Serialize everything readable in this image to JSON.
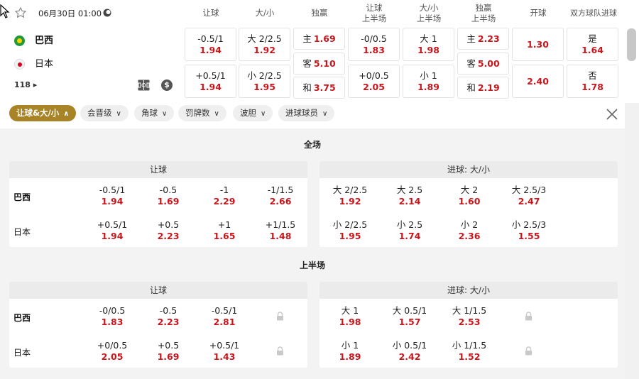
{
  "header": {
    "date": "06月30日 01:00",
    "teams": [
      {
        "name": "巴西",
        "flag": "brazil-flag"
      },
      {
        "name": "日本",
        "flag": "japan-flag"
      }
    ],
    "more_markets": "118",
    "columns": [
      {
        "label": "让球"
      },
      {
        "label": "大/小"
      },
      {
        "label": "独赢"
      },
      {
        "label": "让球\n上半场"
      },
      {
        "label": "大/小\n上半场"
      },
      {
        "label": "独赢\n上半场"
      },
      {
        "label": "开球"
      },
      {
        "label": "双方球队进球"
      }
    ],
    "cells": {
      "hcp_home": {
        "line": "-0.5/1",
        "odds": "1.94"
      },
      "hcp_away": {
        "line": "+0.5/1",
        "odds": "1.94"
      },
      "ou_over": {
        "line": "大 2/2.5",
        "odds": "1.92"
      },
      "ou_under": {
        "line": "小 2/2.5",
        "odds": "1.95"
      },
      "ml_home": {
        "line": "主",
        "odds": "1.69"
      },
      "ml_away": {
        "line": "客",
        "odds": "5.10"
      },
      "ml_draw": {
        "line": "和",
        "odds": "3.75"
      },
      "h1_hcp_home": {
        "line": "-0/0.5",
        "odds": "1.83"
      },
      "h1_hcp_away": {
        "line": "+0/0.5",
        "odds": "2.05"
      },
      "h1_ou_over": {
        "line": "大 1",
        "odds": "1.98"
      },
      "h1_ou_under": {
        "line": "小 1",
        "odds": "1.89"
      },
      "h1_ml_home": {
        "line": "主",
        "odds": "2.23"
      },
      "h1_ml_away": {
        "line": "客",
        "odds": "5.00"
      },
      "h1_ml_draw": {
        "line": "和",
        "odds": "2.19"
      },
      "kickoff_home": {
        "odds": "1.30"
      },
      "kickoff_away": {
        "odds": "2.40"
      },
      "btts_yes": {
        "line": "是",
        "odds": "1.64"
      },
      "btts_no": {
        "line": "否",
        "odds": "1.78"
      }
    }
  },
  "filters": [
    {
      "label": "让球&大/小",
      "active": true
    },
    {
      "label": "会晋级"
    },
    {
      "label": "角球"
    },
    {
      "label": "罚牌数"
    },
    {
      "label": "波胆"
    },
    {
      "label": "进球球员"
    }
  ],
  "sections": [
    {
      "title": "全场",
      "left": {
        "header": "让球",
        "rows": [
          {
            "team": "巴西",
            "odds": [
              {
                "line": "-0.5/1",
                "odds": "1.94"
              },
              {
                "line": "-0.5",
                "odds": "1.69"
              },
              {
                "line": "-1",
                "odds": "2.29"
              },
              {
                "line": "-1/1.5",
                "odds": "2.66"
              }
            ]
          },
          {
            "team": "日本",
            "odds": [
              {
                "line": "+0.5/1",
                "odds": "1.94"
              },
              {
                "line": "+0.5",
                "odds": "2.23"
              },
              {
                "line": "+1",
                "odds": "1.65"
              },
              {
                "line": "+1/1.5",
                "odds": "1.48"
              }
            ]
          }
        ]
      },
      "right": {
        "header": "进球: 大/小",
        "rows": [
          {
            "odds": [
              {
                "line": "大 2/2.5",
                "odds": "1.92"
              },
              {
                "line": "大 2.5",
                "odds": "2.14"
              },
              {
                "line": "大 2",
                "odds": "1.60"
              },
              {
                "line": "大 2.5/3",
                "odds": "2.47"
              }
            ]
          },
          {
            "odds": [
              {
                "line": "小 2/2.5",
                "odds": "1.95"
              },
              {
                "line": "小 2.5",
                "odds": "1.74"
              },
              {
                "line": "小 2",
                "odds": "2.36"
              },
              {
                "line": "小 2.5/3",
                "odds": "1.55"
              }
            ]
          }
        ]
      }
    },
    {
      "title": "上半场",
      "left": {
        "header": "让球",
        "rows": [
          {
            "team": "巴西",
            "odds": [
              {
                "line": "-0/0.5",
                "odds": "1.83"
              },
              {
                "line": "-0.5",
                "odds": "2.23"
              },
              {
                "line": "-0.5/1",
                "odds": "2.81"
              }
            ]
          },
          {
            "team": "日本",
            "odds": [
              {
                "line": "+0/0.5",
                "odds": "2.05"
              },
              {
                "line": "+0.5",
                "odds": "1.69"
              },
              {
                "line": "+0.5/1",
                "odds": "1.43"
              }
            ]
          }
        ]
      },
      "right": {
        "header": "进球: 大/小",
        "rows": [
          {
            "odds": [
              {
                "line": "大 1",
                "odds": "1.98"
              },
              {
                "line": "大 0.5/1",
                "odds": "1.57"
              },
              {
                "line": "大 1/1.5",
                "odds": "2.53"
              }
            ]
          },
          {
            "odds": [
              {
                "line": "小 1",
                "odds": "1.89"
              },
              {
                "line": "小 0.5/1",
                "odds": "2.42"
              },
              {
                "line": "小 1/1.5",
                "odds": "1.52"
              }
            ]
          }
        ]
      }
    }
  ]
}
